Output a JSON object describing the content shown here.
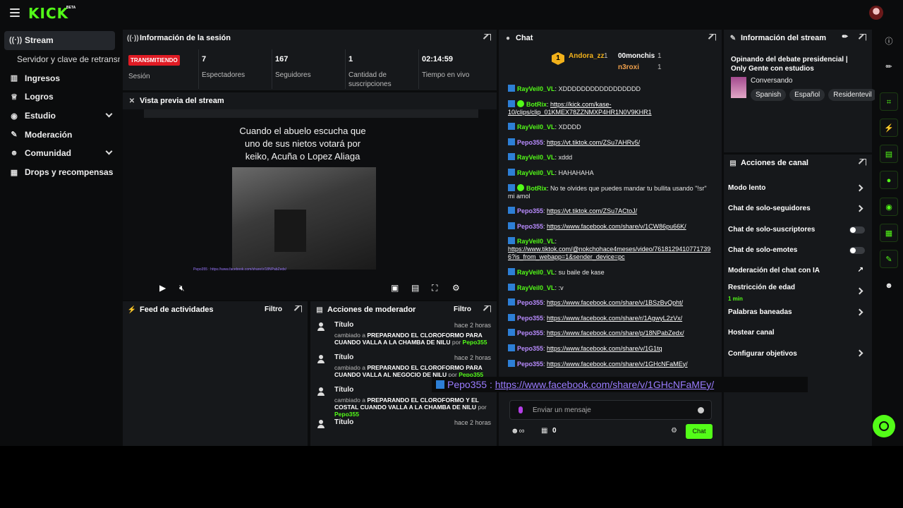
{
  "app": {
    "logo": "KICK",
    "beta": "BETA"
  },
  "sidebar": {
    "items": [
      {
        "label": "Stream",
        "icon": "broadcast-icon"
      },
      {
        "label": "Servidor y clave de retransmisión"
      },
      {
        "label": "Ingresos",
        "icon": "chart-icon"
      },
      {
        "label": "Logros",
        "icon": "trophy-icon"
      },
      {
        "label": "Estudio",
        "icon": "palette-icon"
      },
      {
        "label": "Moderación",
        "icon": "wrench-icon"
      },
      {
        "label": "Comunidad",
        "icon": "users-icon"
      },
      {
        "label": "Drops y recompensas",
        "icon": "gift-icon"
      }
    ]
  },
  "session": {
    "title": "Información de la sesión",
    "status": "TRANSMITIENDO",
    "status_label": "Sesión",
    "viewers": "7",
    "viewers_label": "Espectadores",
    "followers": "167",
    "followers_label": "Seguidores",
    "subs": "1",
    "subs_label": "Cantidad de suscripciones",
    "uptime": "02:14:59",
    "uptime_label": "Tiempo en vivo"
  },
  "preview": {
    "title": "Vista previa del stream",
    "overlay_text": "Cuando el abuelo escucha que uno de sus nietos votará por keiko, Acuña o Lopez Aliaga",
    "chat_overlay": "Pepo355 : https://www.facebook.com/share/v/18NPabZedx/"
  },
  "activity": {
    "title": "Feed de actividades",
    "filter": "Filtro"
  },
  "modactions": {
    "title": "Acciones de moderador",
    "filter": "Filtro",
    "items": [
      {
        "type": "Título",
        "time": "hace 2 horas",
        "prefix": "cambiado a",
        "value": "PREPARANDO EL CLOROFORMO PARA CUANDO VALLA A LA CHAMBA DE NILU",
        "by": "por",
        "user": "Pepo355"
      },
      {
        "type": "Título",
        "time": "hace 2 horas",
        "prefix": "cambiado a",
        "value": "PREPARANDO EL CLOROFORMO PARA CUANDO VALLA AL NEGOCIO DE NILU",
        "by": "por",
        "user": "Pepo355"
      },
      {
        "type": "Título",
        "time": "hace 2 horas",
        "prefix": "cambiado a",
        "value": "PREPARANDO EL CLOROFORMO Y EL COSTAL CUANDO VALLA A LA CHAMBA DE NILU",
        "by": "por",
        "user": "Pepo355"
      },
      {
        "type": "Título",
        "time": "hace 2 horas"
      }
    ]
  },
  "chat": {
    "title": "Chat",
    "leaders": [
      {
        "rank": "1",
        "user": "Andora_zz",
        "count": "1"
      },
      {
        "user": "00monchis",
        "count": "1"
      },
      {
        "user": "n3roxi",
        "count": "1"
      }
    ],
    "messages": [
      {
        "user": "RayVeil0_VL",
        "text": "XDDDDDDDDDDDDDDDDD",
        "badge": "user"
      },
      {
        "user": "BotRix",
        "text": "https://kick.com/kase-10/clips/clip_01KMEX78ZZNMXP4HR1N0V9KHR1",
        "badge": "bot",
        "link": true
      },
      {
        "user": "RayVeil0_VL",
        "text": "XDDDD",
        "badge": "user"
      },
      {
        "user": "Pepo355",
        "text": "https://vt.tiktok.com/ZSu7AHRv5/",
        "badge": "user",
        "link": true
      },
      {
        "user": "RayVeil0_VL",
        "text": "xddd",
        "badge": "user"
      },
      {
        "user": "RayVeil0_VL",
        "text": "HAHAHAHA",
        "badge": "user"
      },
      {
        "user": "BotRix",
        "text": "No te olvides que puedes mandar tu bullita usando \"!sr\" mi amol",
        "badge": "bot"
      },
      {
        "user": "Pepo355",
        "text": "https://vt.tiktok.com/ZSu7ACtoJ/",
        "badge": "user",
        "link": true
      },
      {
        "user": "Pepo355",
        "text": "https://www.facebook.com/share/v/1CW86pu66K/",
        "badge": "user",
        "link": true
      },
      {
        "user": "RayVeil0_VL",
        "text": "https://www.tiktok.com/@nokchohace4meses/video/7618129410771739 6?is_from_webapp=1&sender_device=pc",
        "badge": "user",
        "link": true
      },
      {
        "user": "RayVeil0_VL",
        "text": "su baile de kase",
        "badge": "user"
      },
      {
        "user": "RayVeil0_VL",
        "text": ":v",
        "badge": "user"
      },
      {
        "user": "Pepo355",
        "text": "https://www.facebook.com/share/v/1BSzBvQpht/",
        "badge": "user",
        "link": true
      },
      {
        "user": "Pepo355",
        "text": "https://www.facebook.com/share/r/1AgwyL2zVx/",
        "badge": "user",
        "link": true
      },
      {
        "user": "Pepo355",
        "text": "https://www.facebook.com/share/p/18NPabZedx/",
        "badge": "user",
        "link": true
      },
      {
        "user": "Pepo355",
        "text": "https://www.facebook.com/share/v/1G1tq",
        "badge": "user",
        "link": true
      },
      {
        "user": "Pepo355",
        "text": "https://www.facebook.com/share/v/1GHcNFaMEy/",
        "badge": "user",
        "link": true
      }
    ],
    "pinned_preview": {
      "user": "Pepo355 :",
      "text": "https://www.facebook.com/share/v/1GHcNFaMEy/"
    },
    "input_placeholder": "Enviar un mensaje",
    "points": "0",
    "send_label": "Chat"
  },
  "stream_info": {
    "title_label": "Información del stream",
    "stream_title": "Opinando del debate presidencial | Only Gente con estudios",
    "category": "Conversando",
    "tags": [
      "Spanish",
      "Español",
      "Residentevil"
    ]
  },
  "channel_actions": {
    "title": "Acciones de canal",
    "items": [
      {
        "label": "Modo lento",
        "control": "chevron"
      },
      {
        "label": "Chat de solo-seguidores",
        "control": "chevron"
      },
      {
        "label": "Chat de solo-suscriptores",
        "control": "toggle"
      },
      {
        "label": "Chat de solo-emotes",
        "control": "toggle"
      },
      {
        "label": "Moderación del chat con IA",
        "control": "external"
      },
      {
        "label": "Restricción de edad",
        "sub": "1 min",
        "control": "chevron"
      },
      {
        "label": "Palabras baneadas",
        "control": "chevron"
      },
      {
        "label": "Hostear canal",
        "control": "none"
      },
      {
        "label": "Configurar objetivos",
        "control": "chevron"
      }
    ]
  },
  "colors": {
    "accent": "#53fc18",
    "live": "#e01b24",
    "panel": "#16181b",
    "bg": "#0b0c0d"
  }
}
